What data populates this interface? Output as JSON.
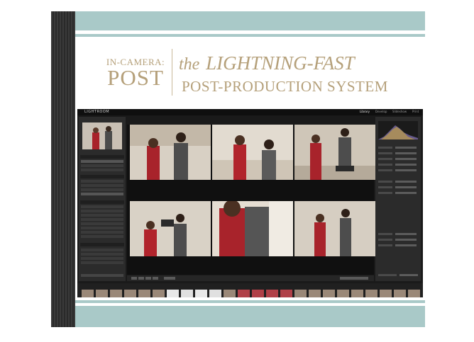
{
  "cover": {
    "title_small": "IN-CAMERA:",
    "title_big": "POST",
    "title_the": "the",
    "title_script": "LIGHTNING-FAST",
    "title_sub": "POST-PRODUCTION SYSTEM"
  },
  "app": {
    "name": "LIGHTROOM",
    "modules": [
      "Library",
      "Develop",
      "Slideshow",
      "Print"
    ]
  },
  "colors": {
    "accent_band": "#a9c9c8",
    "title_gold": "#b5a07a",
    "spine": "#333333",
    "lr_background": "#1a1a1a"
  }
}
